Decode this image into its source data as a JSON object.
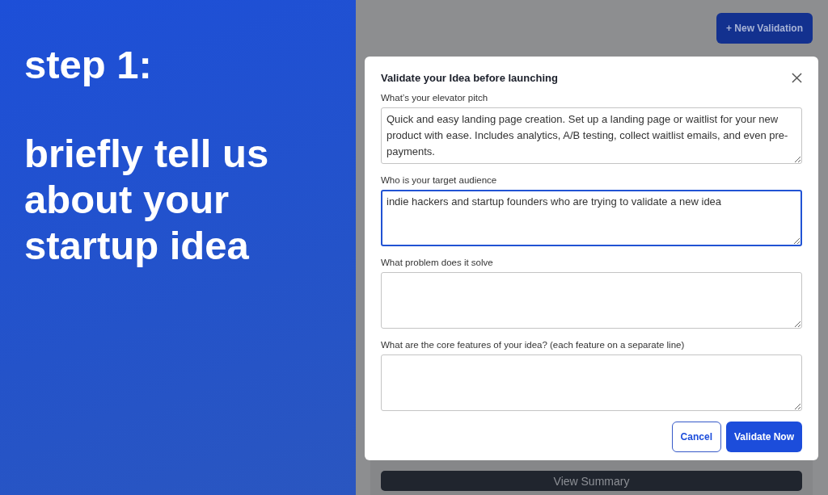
{
  "promo": {
    "step": "step 1:",
    "headline": [
      "briefly tell us",
      "about your",
      "startup idea"
    ]
  },
  "page": {
    "new_button": "+ New Validation",
    "card_button": "View Summary"
  },
  "dialog": {
    "title": "Validate your Idea before launching",
    "fields": [
      {
        "label": "What’s your elevator pitch",
        "value": "Quick and easy landing page creation. Set up a landing page or waitlist for your new product with ease. Includes analytics, A/B testing, collect waitlist emails, and even pre-payments.",
        "focused": false
      },
      {
        "label": "Who is your target audience",
        "value": "indie hackers and startup founders who are trying to validate a new idea",
        "focused": true
      },
      {
        "label": "What problem does it solve",
        "focused": false
      },
      {
        "label": "What are the core features of your idea? (each feature on a separate line)",
        "focused": false
      }
    ],
    "buttons": [
      {
        "label": "Cancel",
        "kind": "secondary"
      },
      {
        "label": "Validate Now",
        "kind": "primary"
      }
    ]
  }
}
